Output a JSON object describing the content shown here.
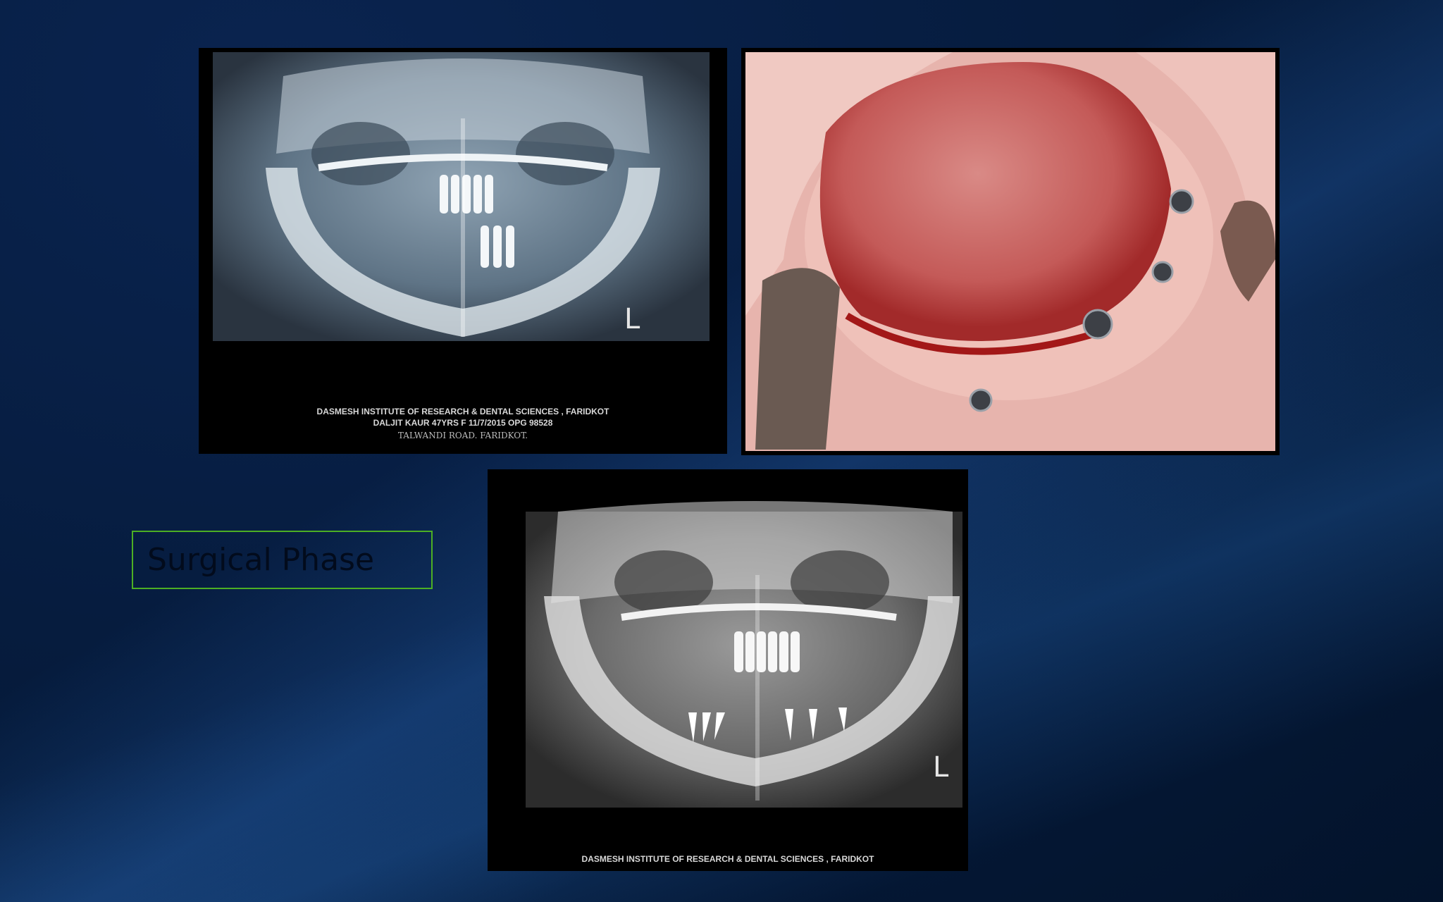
{
  "slide": {
    "caption": "Surgical Phase"
  },
  "xray_preop": {
    "side_marker": "L",
    "footer_line1": "DASMESH INSTITUTE OF RESEARCH & DENTAL SCIENCES , FARIDKOT",
    "footer_line2": "DALJIT KAUR 47YRS F 11/7/2015 OPG 98528",
    "footer_line3": "TALWANDI ROAD. FARIDKOT."
  },
  "xray_postop": {
    "side_marker": "L",
    "footer_line1": "DASMESH INSTITUTE OF RESEARCH & DENTAL SCIENCES , FARIDKOT"
  },
  "colors": {
    "background": "#061a3a",
    "caption_border": "#4caf24"
  }
}
